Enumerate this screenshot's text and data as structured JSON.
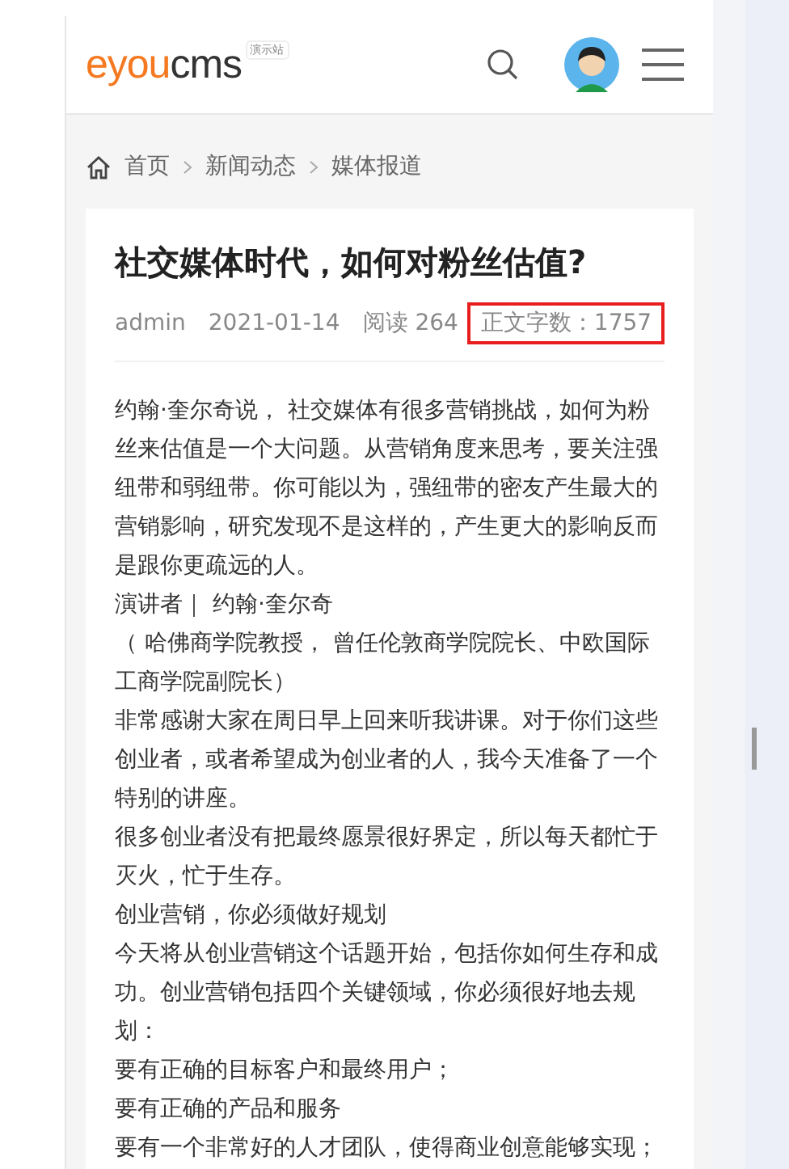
{
  "header": {
    "logo": {
      "primary": "eyou",
      "secondary": "cms"
    },
    "logo_badge": "演示站"
  },
  "breadcrumb": [
    "首页",
    "新闻动态",
    "媒体报道"
  ],
  "article": {
    "title": "社交媒体时代，如何对粉丝估值?",
    "author": "admin",
    "date": "2021-01-14",
    "views": "阅读 264",
    "word_count": "正文字数：1757",
    "paragraphs": [
      "约翰·奎尔奇说， 社交媒体有很多营销挑战，如何为粉丝来估值是一个大问题。从营销角度来思考，要关注强纽带和弱纽带。你可能以为，强纽带的密友产生最大的营销影响，研究发现不是这样的，产生更大的影响反而是跟你更疏远的人。",
      "演讲者｜ 约翰·奎尔奇",
      "（ 哈佛商学院教授， 曾任伦敦商学院院长、中欧国际工商学院副院长）",
      "非常感谢大家在周日早上回来听我讲课。对于你们这些创业者，或者希望成为创业者的人，我今天准备了一个特别的讲座。",
      "很多创业者没有把最终愿景很好界定，所以每天都忙于灭火，忙于生存。",
      "创业营销，你必须做好规划",
      "今天将从创业营销这个话题开始，包括你如何生存和成功。创业营销包括四个关键领域，你必须很好地去规划：",
      "要有正确的目标客户和最终用户；",
      "要有正确的产品和服务",
      "要有一个非常好的人才团队，使得商业创意能够实现；"
    ]
  }
}
